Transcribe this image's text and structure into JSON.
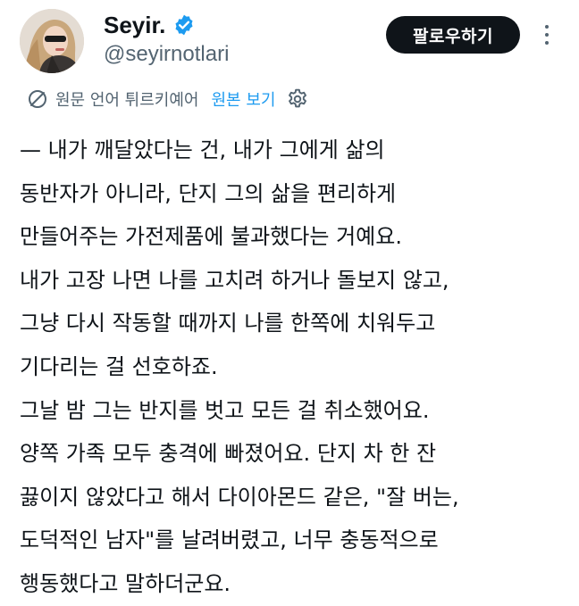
{
  "author": {
    "display_name": "Seyir.",
    "handle": "@seyirnotlari",
    "verified": true,
    "avatar_icon": "profile-photo"
  },
  "actions": {
    "follow_label": "팔로우하기",
    "more_icon": "more-vertical-icon"
  },
  "translation": {
    "note": "원문 언어 튀르키예어",
    "show_original": "원본 보기",
    "globe_icon": "translate-globe-icon",
    "settings_icon": "gear-icon"
  },
  "tweet": {
    "lines": [
      "— 내가 깨달았다는 건, 내가 그에게 삶의",
      "동반자가 아니라, 단지 그의 삶을 편리하게",
      "만들어주는 가전제품에 불과했다는 거예요.",
      "내가 고장 나면 나를 고치려 하거나 돌보지 않고,",
      "그냥 다시 작동할 때까지 나를 한쪽에 치워두고",
      "기다리는 걸 선호하죠.",
      "그날 밤 그는 반지를 벗고 모든 걸 취소했어요.",
      "양쪽 가족 모두 충격에 빠졌어요. 단지 차 한 잔",
      "끓이지 않았다고 해서 다이아몬드 같은, \"잘 버는,",
      "도덕적인 남자\"를 날려버렸고, 너무 충동적으로",
      "행동했다고 말하더군요."
    ]
  },
  "colors": {
    "text": "#0f1419",
    "secondary": "#536471",
    "link": "#1d9bf0",
    "follow_bg": "#0f1419",
    "verified": "#1d9bf0"
  }
}
